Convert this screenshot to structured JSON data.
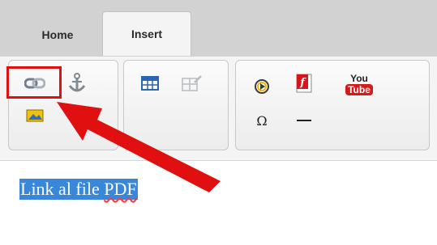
{
  "tabs": [
    {
      "label": "Home"
    },
    {
      "label": "Insert"
    }
  ],
  "ribbon": {
    "links_group": [
      "link-icon",
      "anchor-icon",
      "image-icon"
    ],
    "table_group": [
      "table-icon",
      "table-properties-icon"
    ],
    "media_group": {
      "icons": [
        "video-icon",
        "flash-icon",
        "youtube-icon",
        "omega-icon",
        "horizontal-line-icon"
      ],
      "youtube_top": "You",
      "youtube_bottom": "Tube",
      "omega_symbol": "Ω"
    }
  },
  "editor": {
    "selected_text_prefix": "Link al file ",
    "selected_text_suffix": "PDF"
  },
  "colors": {
    "highlight": "#e01010",
    "selection": "#3a86d8"
  }
}
